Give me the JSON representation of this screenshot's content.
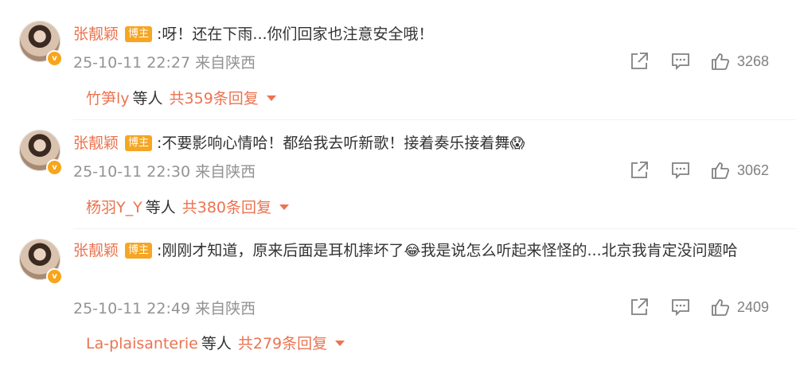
{
  "colors": {
    "accent": "#eb7350",
    "badge": "#f5a623",
    "meta": "#939393"
  },
  "comments": [
    {
      "username": "张靓颖",
      "badge": "博主",
      "text": ":呀！还在下雨...你们回家也注意安全哦！",
      "emoji": "",
      "text_after": "",
      "time": "25-10-11 22:27 来自陕西",
      "likes": "3268",
      "reply_user": "竹笋ly",
      "reply_mid": "等人",
      "reply_count": "共359条回复"
    },
    {
      "username": "张靓颖",
      "badge": "博主",
      "text": ":不要影响心情哈！都给我去听新歌！接着奏乐接着舞",
      "emoji": "😱",
      "text_after": "",
      "time": "25-10-11 22:30 来自陕西",
      "likes": "3062",
      "reply_user": "杨羽Y_Y",
      "reply_mid": "等人",
      "reply_count": "共380条回复"
    },
    {
      "username": "张靓颖",
      "badge": "博主",
      "text": ":刚刚才知道，原来后面是耳机摔坏了",
      "emoji": "😂",
      "text_after": "我是说怎么听起来怪怪的...北京我肯定没问题哈",
      "time": "25-10-11 22:49 来自陕西",
      "likes": "2409",
      "reply_user": "La-plaisanterie",
      "reply_mid": "等人",
      "reply_count": "共279条回复"
    }
  ]
}
